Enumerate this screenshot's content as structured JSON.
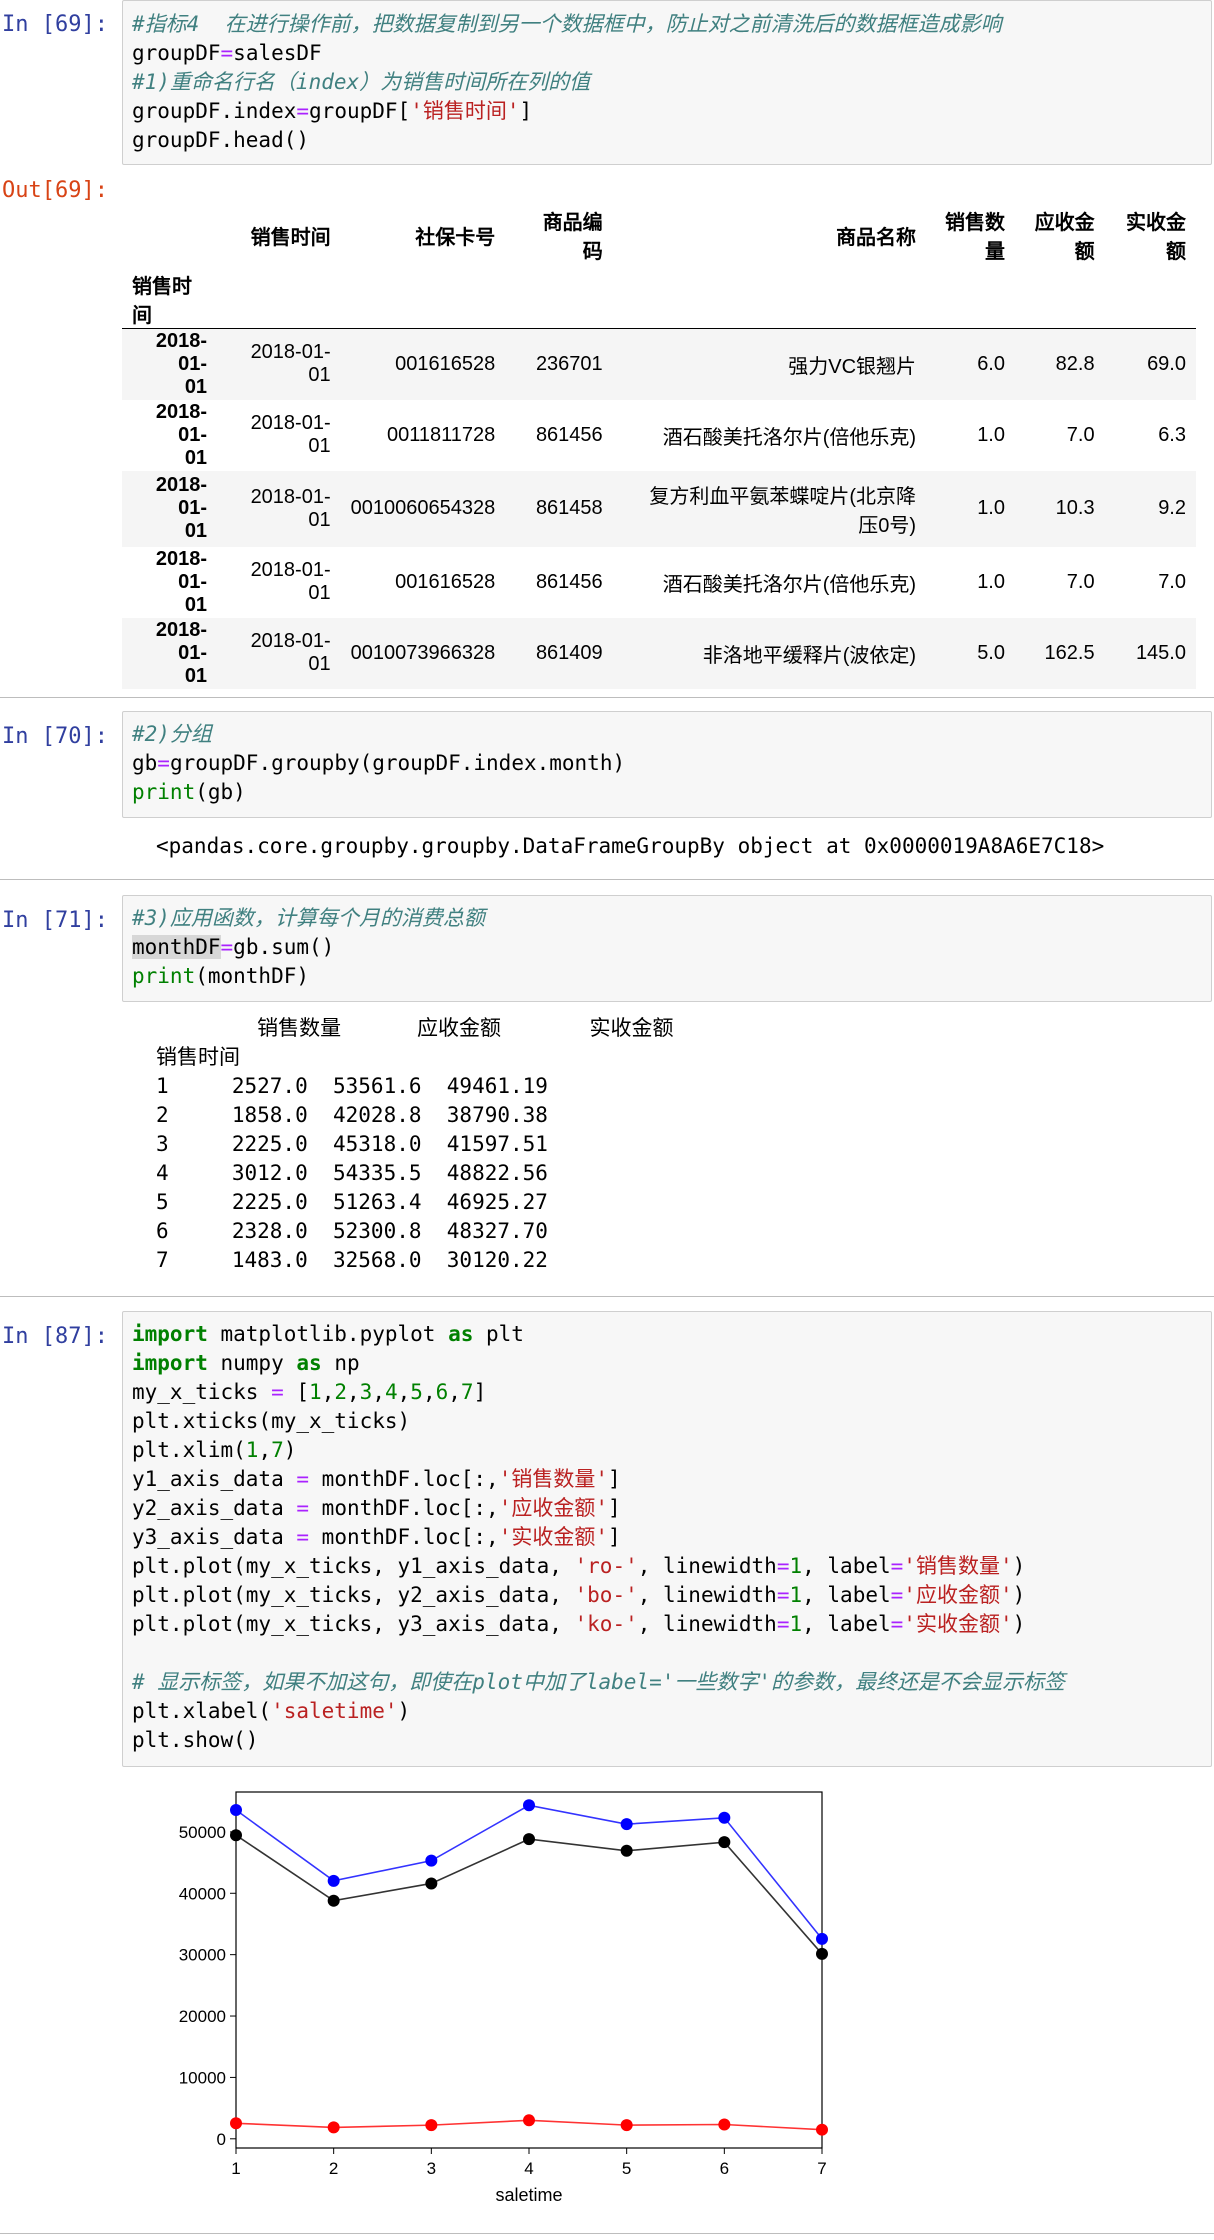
{
  "cell69": {
    "in_prompt": "In  [69]:",
    "out_prompt": "Out[69]:",
    "code": [
      [
        {
          "t": "#指标4  在进行操作前，把数据复制到另一个数据框中，防止对之前清洗后的数据框造成影响",
          "c": "cm"
        }
      ],
      [
        {
          "t": "groupDF"
        },
        {
          "t": "=",
          "c": "op"
        },
        {
          "t": "salesDF"
        }
      ],
      [
        {
          "t": "#1)重命名行名（index）为销售时间所在列的值",
          "c": "cm"
        }
      ],
      [
        {
          "t": "groupDF.index"
        },
        {
          "t": "=",
          "c": "op"
        },
        {
          "t": "groupDF["
        },
        {
          "t": "'销售时间'",
          "c": "st"
        },
        {
          "t": "]"
        }
      ],
      [
        {
          "t": "groupDF.head()"
        }
      ]
    ],
    "table": {
      "columns": [
        "销售时间",
        "社保卡号",
        "商品编码",
        "商品名称",
        "销售数量",
        "应收金额",
        "实收金额"
      ],
      "column_headers_display": [
        [
          "销售时间"
        ],
        [
          "社保卡号"
        ],
        [
          "商品编",
          "码"
        ],
        [
          "商品名称"
        ],
        [
          "销售数",
          "量"
        ],
        [
          "应收金",
          "额"
        ],
        [
          "实收金",
          "额"
        ]
      ],
      "index_name": "销售时间",
      "rows": [
        {
          "index": [
            "2018-01-",
            "01"
          ],
          "cells": [
            [
              "2018-01-",
              "01"
            ],
            [
              "001616528"
            ],
            [
              "236701"
            ],
            [
              "强力VC银翘片"
            ],
            [
              "6.0"
            ],
            [
              "82.8"
            ],
            [
              "69.0"
            ]
          ]
        },
        {
          "index": [
            "2018-01-",
            "01"
          ],
          "cells": [
            [
              "2018-01-",
              "01"
            ],
            [
              "0011811728"
            ],
            [
              "861456"
            ],
            [
              "酒石酸美托洛尔片(倍他乐克)"
            ],
            [
              "1.0"
            ],
            [
              "7.0"
            ],
            [
              "6.3"
            ]
          ]
        },
        {
          "index": [
            "2018-01-",
            "01"
          ],
          "cells": [
            [
              "2018-01-",
              "01"
            ],
            [
              "0010060654328"
            ],
            [
              "861458"
            ],
            [
              "复方利血平氨苯蝶啶片(北京降",
              "压0号)"
            ],
            [
              "1.0"
            ],
            [
              "10.3"
            ],
            [
              "9.2"
            ]
          ]
        },
        {
          "index": [
            "2018-01-",
            "01"
          ],
          "cells": [
            [
              "2018-01-",
              "01"
            ],
            [
              "001616528"
            ],
            [
              "861456"
            ],
            [
              "酒石酸美托洛尔片(倍他乐克)"
            ],
            [
              "1.0"
            ],
            [
              "7.0"
            ],
            [
              "7.0"
            ]
          ]
        },
        {
          "index": [
            "2018-01-",
            "01"
          ],
          "cells": [
            [
              "2018-01-",
              "01"
            ],
            [
              "0010073966328"
            ],
            [
              "861409"
            ],
            [
              "非洛地平缓释片(波依定)"
            ],
            [
              "5.0"
            ],
            [
              "162.5"
            ],
            [
              "145.0"
            ]
          ]
        }
      ]
    }
  },
  "cell70": {
    "in_prompt": "In  [70]:",
    "code": [
      [
        {
          "t": "#2)分组",
          "c": "cm"
        }
      ],
      [
        {
          "t": "gb"
        },
        {
          "t": "=",
          "c": "op"
        },
        {
          "t": "groupDF.groupby(groupDF.index.month)"
        }
      ],
      [
        {
          "t": "print",
          "c": "bi"
        },
        {
          "t": "(gb)"
        }
      ]
    ],
    "output": "<pandas.core.groupby.groupby.DataFrameGroupBy object at 0x0000019A8A6E7C18>"
  },
  "cell71": {
    "in_prompt": "In  [71]:",
    "code": [
      [
        {
          "t": "#3)应用函数，计算每个月的消费总额",
          "c": "cm"
        }
      ],
      [
        {
          "t": "monthDF",
          "c": "sel"
        },
        {
          "t": "=",
          "c": "op"
        },
        {
          "t": "gb.sum()"
        }
      ],
      [
        {
          "t": "print",
          "c": "bi"
        },
        {
          "t": "(monthDF)"
        }
      ]
    ],
    "output_header": "        销售数量      应收金额       实收金额",
    "output_index_name": "销售时间",
    "output_rows": [
      "1     2527.0  53561.6  49461.19",
      "2     1858.0  42028.8  38790.38",
      "3     2225.0  45318.0  41597.51",
      "4     3012.0  54335.5  48822.56",
      "5     2225.0  51263.4  46925.27",
      "6     2328.0  52300.8  48327.70",
      "7     1483.0  32568.0  30120.22"
    ]
  },
  "cell87": {
    "in_prompt": "In  [87]:",
    "code": [
      [
        {
          "t": "import",
          "c": "kw"
        },
        {
          "t": " matplotlib.pyplot "
        },
        {
          "t": "as",
          "c": "kw"
        },
        {
          "t": " plt"
        }
      ],
      [
        {
          "t": "import",
          "c": "kw"
        },
        {
          "t": " numpy "
        },
        {
          "t": "as",
          "c": "kw"
        },
        {
          "t": " np"
        }
      ],
      [
        {
          "t": "my_x_ticks "
        },
        {
          "t": "=",
          "c": "op"
        },
        {
          "t": " ["
        },
        {
          "t": "1",
          "c": "nu"
        },
        {
          "t": ","
        },
        {
          "t": "2",
          "c": "nu"
        },
        {
          "t": ","
        },
        {
          "t": "3",
          "c": "nu"
        },
        {
          "t": ","
        },
        {
          "t": "4",
          "c": "nu"
        },
        {
          "t": ","
        },
        {
          "t": "5",
          "c": "nu"
        },
        {
          "t": ","
        },
        {
          "t": "6",
          "c": "nu"
        },
        {
          "t": ","
        },
        {
          "t": "7",
          "c": "nu"
        },
        {
          "t": "]"
        }
      ],
      [
        {
          "t": "plt.xticks(my_x_ticks)"
        }
      ],
      [
        {
          "t": "plt.xlim("
        },
        {
          "t": "1",
          "c": "nu"
        },
        {
          "t": ","
        },
        {
          "t": "7",
          "c": "nu"
        },
        {
          "t": ")"
        }
      ],
      [
        {
          "t": "y1_axis_data "
        },
        {
          "t": "=",
          "c": "op"
        },
        {
          "t": " monthDF.loc[:,"
        },
        {
          "t": "'销售数量'",
          "c": "st"
        },
        {
          "t": "]"
        }
      ],
      [
        {
          "t": "y2_axis_data "
        },
        {
          "t": "=",
          "c": "op"
        },
        {
          "t": " monthDF.loc[:,"
        },
        {
          "t": "'应收金额'",
          "c": "st"
        },
        {
          "t": "]"
        }
      ],
      [
        {
          "t": "y3_axis_data "
        },
        {
          "t": "=",
          "c": "op"
        },
        {
          "t": " monthDF.loc[:,"
        },
        {
          "t": "'实收金额'",
          "c": "st"
        },
        {
          "t": "]"
        }
      ],
      [
        {
          "t": "plt.plot(my_x_ticks, y1_axis_data, "
        },
        {
          "t": "'ro-'",
          "c": "st"
        },
        {
          "t": ", linewidth"
        },
        {
          "t": "=",
          "c": "op"
        },
        {
          "t": "1",
          "c": "nu"
        },
        {
          "t": ", label"
        },
        {
          "t": "=",
          "c": "op"
        },
        {
          "t": "'销售数量'",
          "c": "st"
        },
        {
          "t": ")"
        }
      ],
      [
        {
          "t": "plt.plot(my_x_ticks, y2_axis_data, "
        },
        {
          "t": "'bo-'",
          "c": "st"
        },
        {
          "t": ", linewidth"
        },
        {
          "t": "=",
          "c": "op"
        },
        {
          "t": "1",
          "c": "nu"
        },
        {
          "t": ", label"
        },
        {
          "t": "=",
          "c": "op"
        },
        {
          "t": "'应收金额'",
          "c": "st"
        },
        {
          "t": ")"
        }
      ],
      [
        {
          "t": "plt.plot(my_x_ticks, y3_axis_data, "
        },
        {
          "t": "'ko-'",
          "c": "st"
        },
        {
          "t": ", linewidth"
        },
        {
          "t": "=",
          "c": "op"
        },
        {
          "t": "1",
          "c": "nu"
        },
        {
          "t": ", label"
        },
        {
          "t": "=",
          "c": "op"
        },
        {
          "t": "'实收金额'",
          "c": "st"
        },
        {
          "t": ")"
        }
      ],
      [
        {
          "t": ""
        }
      ],
      [
        {
          "t": "# 显示标签，如果不加这句，即使在plot中加了label='一些数字'的参数，最终还是不会显示标签",
          "c": "cm"
        }
      ],
      [
        {
          "t": "plt.xlabel("
        },
        {
          "t": "'saletime'",
          "c": "st"
        },
        {
          "t": ")"
        }
      ],
      [
        {
          "t": "plt.show()"
        }
      ]
    ]
  },
  "chart_data": {
    "type": "line",
    "xlabel": "saletime",
    "x": [
      1,
      2,
      3,
      4,
      5,
      6,
      7
    ],
    "xlim": [
      1,
      7
    ],
    "yticks": [
      0,
      10000,
      20000,
      30000,
      40000,
      50000
    ],
    "legend": "none",
    "grid": "off",
    "series": [
      {
        "color": "#ff0000",
        "values": [
          2527.0,
          1858.0,
          2225.0,
          3012.0,
          2225.0,
          2328.0,
          1483.0
        ]
      },
      {
        "color": "#0000ff",
        "values": [
          53561.6,
          42028.8,
          45318.0,
          54335.5,
          51263.4,
          52300.8,
          32568.0
        ]
      },
      {
        "color": "#000000",
        "values": [
          49461.19,
          38790.38,
          41597.51,
          48822.56,
          46925.27,
          48327.7,
          30120.22
        ]
      }
    ]
  }
}
